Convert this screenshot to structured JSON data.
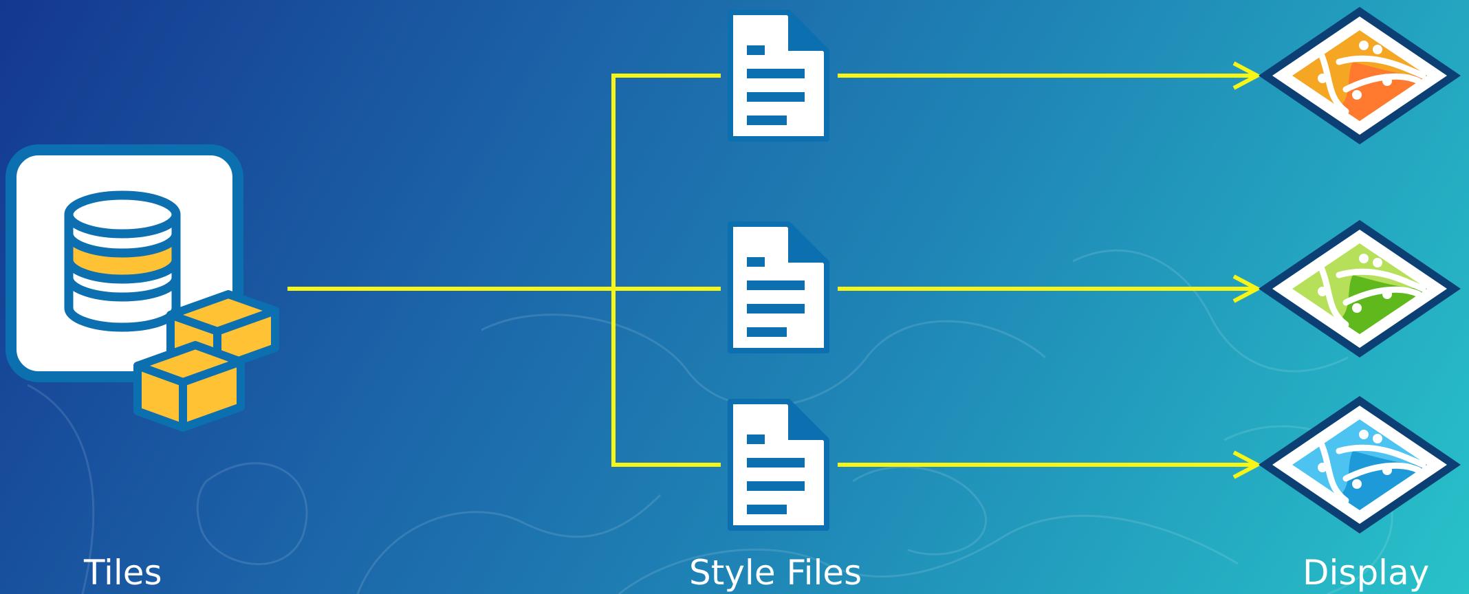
{
  "labels": {
    "tiles": "Tiles",
    "style_files": "Style Files",
    "display": "Display"
  },
  "nodes": {
    "tiles": {
      "icon": "database-tiles-icon"
    },
    "style_files": [
      {
        "icon": "style-file-icon"
      },
      {
        "icon": "style-file-icon"
      },
      {
        "icon": "style-file-icon"
      }
    ],
    "displays": [
      {
        "icon": "map-display-icon",
        "primary": "#f5a623",
        "secondary": "#ff7a2e",
        "outline": "#0c3f73"
      },
      {
        "icon": "map-display-icon",
        "primary": "#b7e05a",
        "secondary": "#5fb81c",
        "outline": "#0c3f73"
      },
      {
        "icon": "map-display-icon",
        "primary": "#4cc3f0",
        "secondary": "#1e9ad9",
        "outline": "#0c3f73"
      }
    ]
  },
  "colors": {
    "connector": "#f7f417",
    "label_text": "#ffffff",
    "icon_outline": "#0b6fb0",
    "tile_fill": "#ffc234"
  }
}
